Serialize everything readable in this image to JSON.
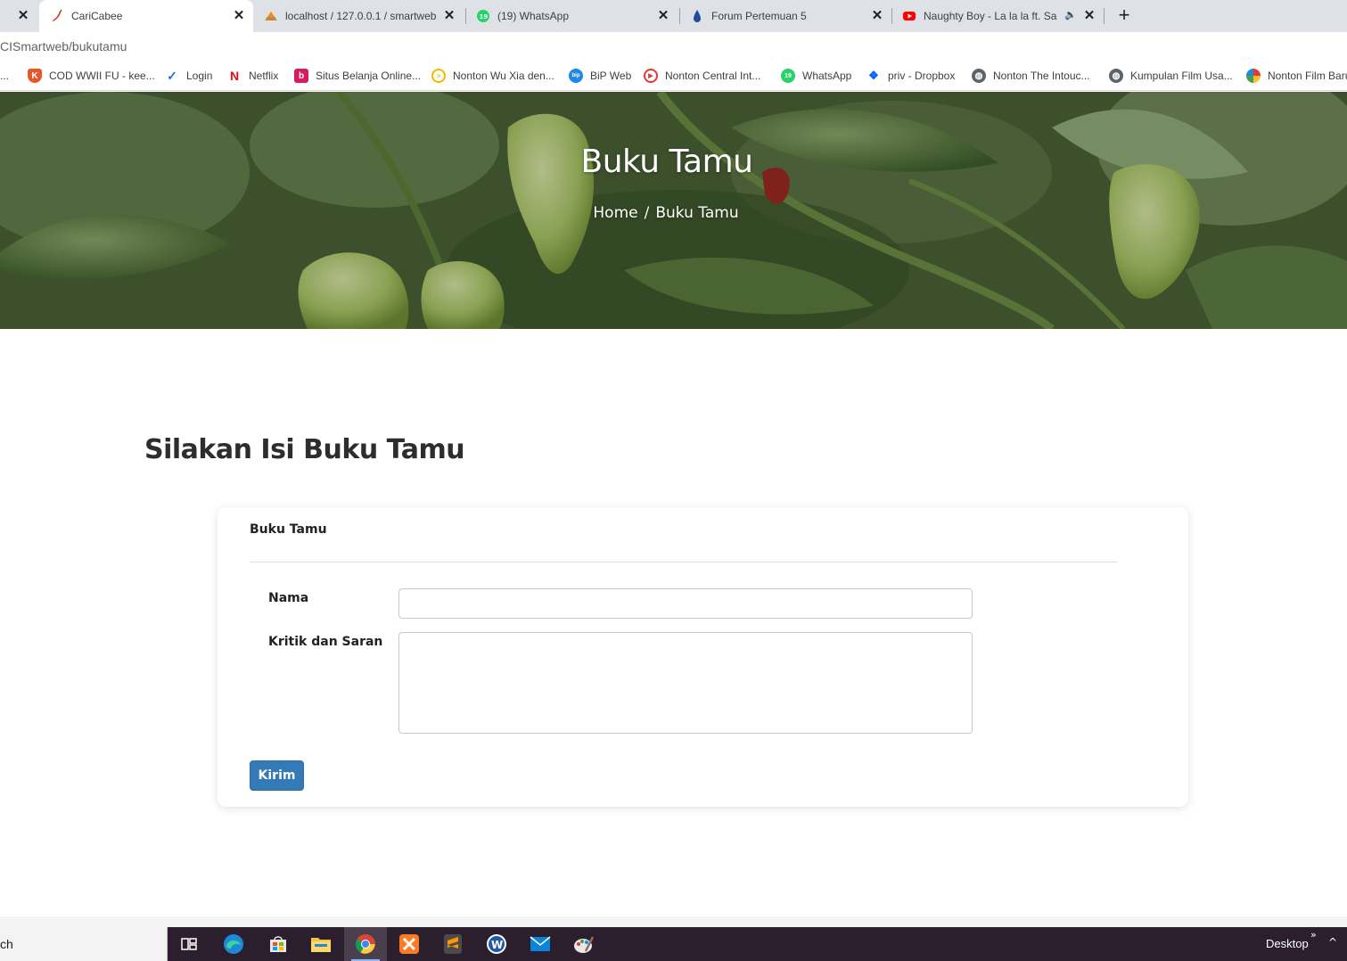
{
  "browser": {
    "tabs": [
      {
        "title": "",
        "active": false,
        "icon": "close-only"
      },
      {
        "title": "CariCabee",
        "active": true,
        "icon": "chili-icon"
      },
      {
        "title": "localhost / 127.0.0.1 / smartweb",
        "active": false,
        "icon": "phpmyadmin-icon"
      },
      {
        "title": "(19) WhatsApp",
        "active": false,
        "icon": "whatsapp-icon"
      },
      {
        "title": "Forum Pertemuan 5",
        "active": false,
        "icon": "droplet-icon"
      },
      {
        "title": "Naughty Boy - La la la ft. Sam",
        "active": false,
        "icon": "youtube-icon"
      }
    ],
    "new_tab_label": "+",
    "close_glyph": "✕",
    "audio_glyph": "🔈",
    "url": "CISmartweb/bukutamu",
    "bookmarks": [
      {
        "label": "...",
        "icon": "overflow",
        "color": "#5f6368"
      },
      {
        "label": "COD WWII FU - kee...",
        "icon": "k-shield-icon",
        "color": "#e8572a"
      },
      {
        "label": "Login",
        "icon": "check-icon",
        "color": "#1a73e8"
      },
      {
        "label": "Netflix",
        "icon": "netflix-icon",
        "color": "#e50914"
      },
      {
        "label": "Situs Belanja Online...",
        "icon": "shop-icon",
        "color": "#d81b60"
      },
      {
        "label": "Nonton Wu Xia den...",
        "icon": "play-circle-icon",
        "color": "#f5b800"
      },
      {
        "label": "BiP Web",
        "icon": "bip-icon",
        "color": "#1e88e5"
      },
      {
        "label": "Nonton Central Int...",
        "icon": "play-icon",
        "color": "#e53935"
      },
      {
        "label": "WhatsApp",
        "icon": "whatsapp-icon",
        "color": "#25d366"
      },
      {
        "label": "priv - Dropbox",
        "icon": "dropbox-icon",
        "color": "#0061ff"
      },
      {
        "label": "Nonton The Intouc...",
        "icon": "globe-icon",
        "color": "#5f6368"
      },
      {
        "label": "Kumpulan Film Usa...",
        "icon": "globe-icon",
        "color": "#5f6368"
      },
      {
        "label": "Nonton Film Baru",
        "icon": "pinwheel-icon",
        "color": "#e53935"
      }
    ]
  },
  "hero": {
    "title": "Buku Tamu",
    "breadcrumb": {
      "home": "Home",
      "separator": "/",
      "current": "Buku Tamu"
    }
  },
  "main": {
    "heading": "Silakan Isi Buku Tamu",
    "card": {
      "title": "Buku Tamu",
      "fields": {
        "nama": {
          "label": "Nama",
          "value": ""
        },
        "kritik": {
          "label": "Kritik dan Saran",
          "value": ""
        }
      },
      "submit_label": "Kirim"
    }
  },
  "taskbar": {
    "search_text": "ch",
    "desktop_label": "Desktop",
    "chevron": "»",
    "up_arrow": "^",
    "apps": [
      "task-view-icon",
      "edge-icon",
      "store-icon",
      "file-explorer-icon",
      "chrome-icon",
      "xampp-icon",
      "sublime-icon",
      "wordpad-icon",
      "mail-icon",
      "paint-icon"
    ]
  },
  "colors": {
    "primary_button": "#337ab7",
    "heading_text": "#2d2d2d",
    "taskbar_bg": "#2b1f2e"
  }
}
